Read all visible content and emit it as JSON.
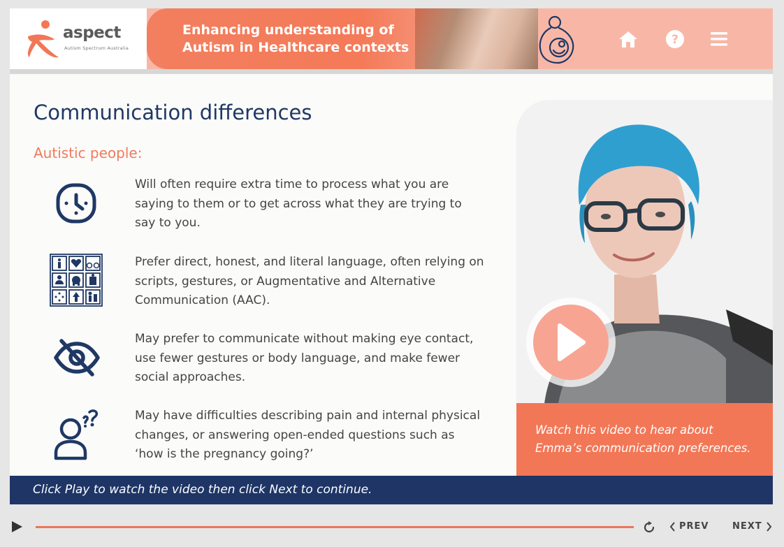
{
  "header": {
    "logo_text": "aspect",
    "logo_subtext": "Autism Spectrum Australia",
    "course_title_line1": "Enhancing understanding of",
    "course_title_line2": "Autism in Healthcare contexts",
    "nav_icons": [
      "home-icon",
      "help-icon",
      "menu-icon"
    ]
  },
  "content": {
    "title": "Communication differences",
    "subtitle": "Autistic people:",
    "items": [
      {
        "icon": "clock-icon",
        "text": "Will often require extra time to process what you are saying to them or to get across what they are trying to say to you."
      },
      {
        "icon": "aac-board-icon",
        "text": "Prefer direct, honest, and literal language, often relying on scripts, gestures, or Augmentative and Alternative Communication (AAC)."
      },
      {
        "icon": "eye-off-icon",
        "text": "May prefer to communicate without making eye contact, use fewer gestures or body language, and make fewer social approaches."
      },
      {
        "icon": "person-question-icon",
        "text": "May have difficulties describing pain and internal physical changes, or answering open-ended questions such as ‘how is the pregnancy going?’"
      }
    ]
  },
  "video": {
    "caption_line1": "Watch this video to hear about",
    "caption_line2": "Emma’s communication preferences."
  },
  "instruction": "Click Play to watch the video then click Next to continue.",
  "player": {
    "prev_label": "PREV",
    "next_label": "NEXT"
  },
  "colors": {
    "accent": "#f27757",
    "navy": "#1e3566",
    "title": "#1f3864",
    "header_pink": "#f8b7a6"
  }
}
